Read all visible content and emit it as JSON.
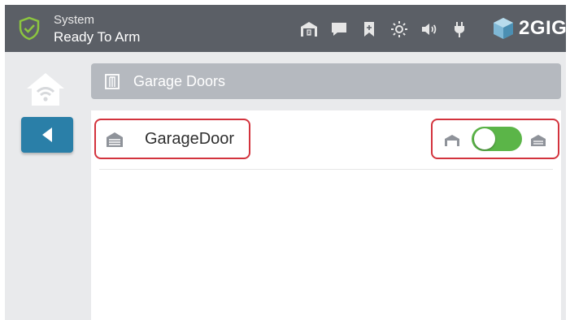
{
  "header": {
    "status_top": "System",
    "status_bottom": "Ready To Arm",
    "brand": "2GIG",
    "status_icons": [
      "garage-icon",
      "message-icon",
      "bookmark-icon",
      "brightness-icon",
      "volume-icon",
      "power-plug-icon"
    ],
    "colors": {
      "bar": "#5b5f66",
      "shield": "#8cc63f"
    }
  },
  "breadcrumb": {
    "label": "Garage Doors"
  },
  "devices": [
    {
      "name": "GarageDoor",
      "toggle_on": true
    }
  ],
  "colors": {
    "accent": "#2a7fa8",
    "toggle_on": "#5bb548",
    "highlight": "#d3333d"
  }
}
